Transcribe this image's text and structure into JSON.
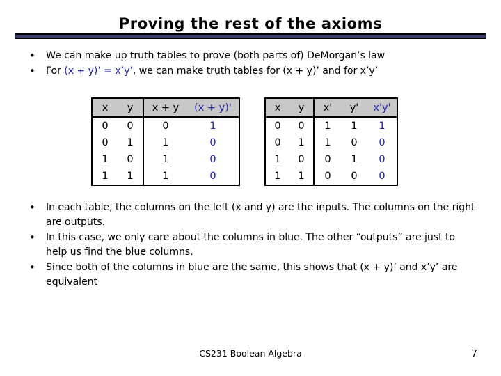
{
  "slide": {
    "title": "Proving the rest of the axioms",
    "bullet_marker": "•"
  },
  "bullets_top": [
    {
      "segments": [
        {
          "text": "We can make up truth tables to prove (both parts of) DeMorgan’s law",
          "color": "black"
        }
      ]
    },
    {
      "segments": [
        {
          "text": "For ",
          "color": "black"
        },
        {
          "text": "(x + y)’ = x’y’",
          "color": "blue"
        },
        {
          "text": ", we can make truth tables for (x + y)’ and for x’y’",
          "color": "black"
        }
      ]
    }
  ],
  "bullets_bottom": [
    {
      "segments": [
        {
          "text": "In each table, the columns on the left (x and y) are the inputs. The columns on the right are outputs.",
          "color": "black"
        }
      ]
    },
    {
      "segments": [
        {
          "text": "In this case, we only care about the columns in blue. The other “outputs” are just to help us find the blue columns.",
          "color": "black"
        }
      ]
    },
    {
      "segments": [
        {
          "text": "Since both of the columns in blue are the same, this shows that (x + y)’ and x’y’ are equivalent",
          "color": "black"
        }
      ]
    }
  ],
  "table_left": {
    "headers": [
      {
        "label": "x",
        "color": "black",
        "group": "input"
      },
      {
        "label": "y",
        "color": "black",
        "group": "input"
      },
      {
        "label": "x + y",
        "color": "black",
        "group": "output"
      },
      {
        "label": "(x + y)'",
        "color": "blue",
        "group": "output"
      }
    ],
    "rows": [
      [
        "0",
        "0",
        "0",
        "1"
      ],
      [
        "0",
        "1",
        "1",
        "0"
      ],
      [
        "1",
        "0",
        "1",
        "0"
      ],
      [
        "1",
        "1",
        "1",
        "0"
      ]
    ]
  },
  "table_right": {
    "headers": [
      {
        "label": "x",
        "color": "black",
        "group": "input"
      },
      {
        "label": "y",
        "color": "black",
        "group": "input"
      },
      {
        "label": "x'",
        "color": "black",
        "group": "output"
      },
      {
        "label": "y'",
        "color": "black",
        "group": "output"
      },
      {
        "label": "x'y'",
        "color": "blue",
        "group": "output"
      }
    ],
    "rows": [
      [
        "0",
        "0",
        "1",
        "1",
        "1"
      ],
      [
        "0",
        "1",
        "1",
        "0",
        "0"
      ],
      [
        "1",
        "0",
        "0",
        "1",
        "0"
      ],
      [
        "1",
        "1",
        "0",
        "0",
        "0"
      ]
    ]
  },
  "footer": {
    "center": "CS231 Boolean Algebra",
    "page": "7"
  },
  "colors": {
    "highlight_blue": "#2323a8",
    "rule_navy": "#3b3b72",
    "header_gray": "#c8c8c8"
  }
}
